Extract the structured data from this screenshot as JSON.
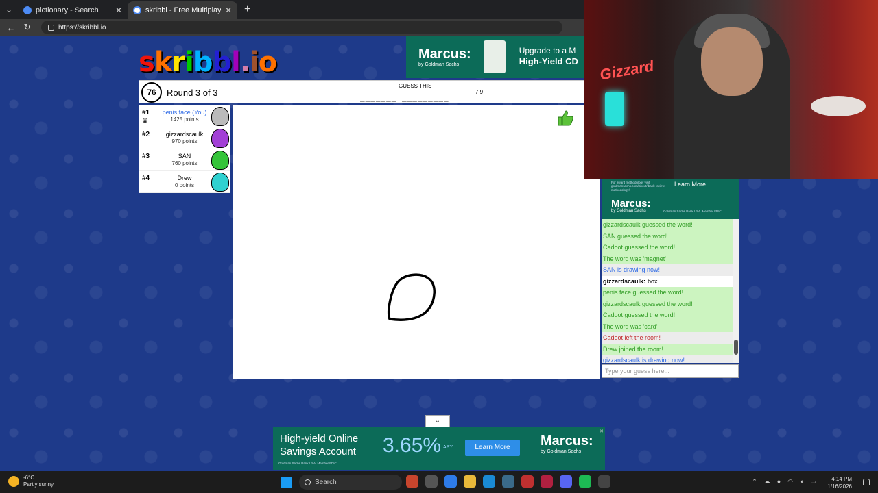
{
  "browser": {
    "tabs": [
      {
        "title": "pictionary - Search",
        "active": false
      },
      {
        "title": "skribbl - Free Multiplayer Drawing",
        "active": true
      }
    ],
    "url": "https://skribbl.io"
  },
  "logo": {
    "text": "skribbl.io"
  },
  "top_ad": {
    "brand": "Marcus:",
    "brand_sub": "by Goldman Sachs",
    "line1": "Upgrade to a M",
    "line2": "High-Yield CD"
  },
  "game": {
    "timer": "76",
    "round": "Round 3 of 3",
    "guess_label": "GUESS THIS",
    "word_pattern": "_______ _________",
    "word_lengths": "7 9"
  },
  "players": [
    {
      "rank": "#1",
      "name": "penis face (You)",
      "points": "1425 points",
      "you": true,
      "color": "#bbbbbb"
    },
    {
      "rank": "#2",
      "name": "gizzardscaulk",
      "points": "970 points",
      "you": false,
      "color": "#a240d6"
    },
    {
      "rank": "#3",
      "name": "SAN",
      "points": "760 points",
      "you": false,
      "color": "#35c43a"
    },
    {
      "rank": "#4",
      "name": "Drew",
      "points": "0 points",
      "you": false,
      "color": "#2fd1d0"
    }
  ],
  "chat_ad": {
    "small_text": "For award methodology visit goldmansachs.com/about/ bank review methodology/",
    "learn_more": "Learn More",
    "brand": "Marcus:",
    "brand_sub": "by Goldman Sachs",
    "fine": "Goldman Sachs Bank USA. Member FDIC."
  },
  "chat": {
    "messages": [
      {
        "text": "gizzardscaulk guessed the word!",
        "style": "green"
      },
      {
        "text": "SAN guessed the word!",
        "style": "green"
      },
      {
        "text": "Cadoot guessed the word!",
        "style": "green"
      },
      {
        "text": "The word was 'magnet'",
        "style": "green"
      },
      {
        "text": "SAN is drawing now!",
        "style": "blue"
      },
      {
        "author": "gizzardscaulk:",
        "text": "box",
        "style": "plain"
      },
      {
        "text": "penis face guessed the word!",
        "style": "green"
      },
      {
        "text": "gizzardscaulk guessed the word!",
        "style": "green"
      },
      {
        "text": "Cadoot guessed the word!",
        "style": "green"
      },
      {
        "text": "The word was 'card'",
        "style": "green"
      },
      {
        "text": "Cadoot left the room!",
        "style": "red"
      },
      {
        "text": "Drew joined the room!",
        "style": "green"
      },
      {
        "text": "gizzardscaulk is drawing now!",
        "style": "blue"
      }
    ],
    "input_placeholder": "Type your guess here..."
  },
  "bottom_ad": {
    "headline": "High-yield Online Savings Account",
    "fine": "Goldman Sachs Bank USA. Member FDIC.",
    "rate": "3.65%",
    "apy": "APY",
    "button": "Learn More",
    "brand": "Marcus:",
    "brand_sub": "by Goldman Sachs"
  },
  "taskbar": {
    "weather_temp": "-6°C",
    "weather_desc": "Partly sunny",
    "search": "Search",
    "time": "4:14 PM",
    "date": "1/16/2026"
  },
  "webcam": {
    "neon_text": "Gizzard"
  }
}
